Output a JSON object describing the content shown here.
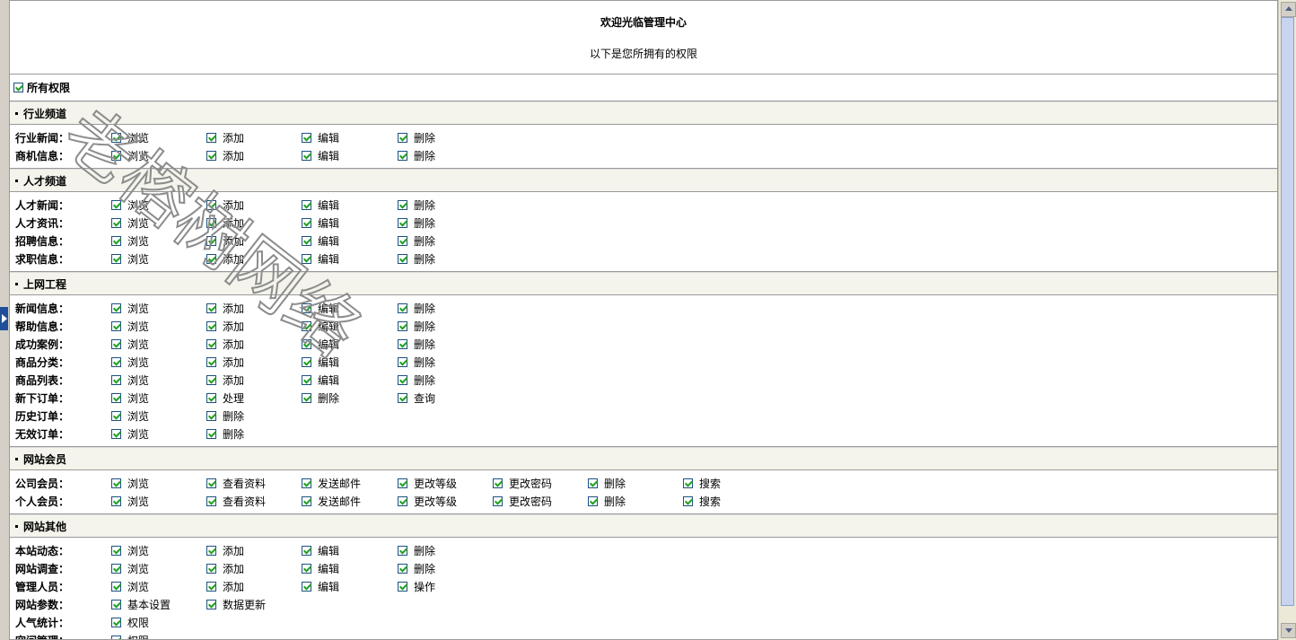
{
  "header": {
    "welcome": "欢迎光临管理中心",
    "subtitle": "以下是您所拥有的权限"
  },
  "all_permissions": {
    "label": "所有权限",
    "checked": true
  },
  "sections": [
    {
      "title": "行业频道",
      "rows": [
        {
          "label": "行业新闻：",
          "perms": [
            "浏览",
            "添加",
            "编辑",
            "删除"
          ]
        },
        {
          "label": "商机信息：",
          "perms": [
            "浏览",
            "添加",
            "编辑",
            "删除"
          ]
        }
      ]
    },
    {
      "title": "人才频道",
      "rows": [
        {
          "label": "人才新闻：",
          "perms": [
            "浏览",
            "添加",
            "编辑",
            "删除"
          ]
        },
        {
          "label": "人才资讯：",
          "perms": [
            "浏览",
            "添加",
            "编辑",
            "删除"
          ]
        },
        {
          "label": "招聘信息：",
          "perms": [
            "浏览",
            "添加",
            "编辑",
            "删除"
          ]
        },
        {
          "label": "求职信息：",
          "perms": [
            "浏览",
            "添加",
            "编辑",
            "删除"
          ]
        }
      ]
    },
    {
      "title": "上网工程",
      "rows": [
        {
          "label": "新闻信息：",
          "perms": [
            "浏览",
            "添加",
            "编辑",
            "删除"
          ]
        },
        {
          "label": "帮助信息：",
          "perms": [
            "浏览",
            "添加",
            "编辑",
            "删除"
          ]
        },
        {
          "label": "成功案例：",
          "perms": [
            "浏览",
            "添加",
            "编辑",
            "删除"
          ]
        },
        {
          "label": "商品分类：",
          "perms": [
            "浏览",
            "添加",
            "编辑",
            "删除"
          ]
        },
        {
          "label": "商品列表：",
          "perms": [
            "浏览",
            "添加",
            "编辑",
            "删除"
          ]
        },
        {
          "label": "新下订单：",
          "perms": [
            "浏览",
            "处理",
            "删除",
            "查询"
          ]
        },
        {
          "label": "历史订单：",
          "perms": [
            "浏览",
            "删除"
          ]
        },
        {
          "label": "无效订单：",
          "perms": [
            "浏览",
            "删除"
          ]
        }
      ]
    },
    {
      "title": "网站会员",
      "rows": [
        {
          "label": "公司会员：",
          "perms": [
            "浏览",
            "查看资料",
            "发送邮件",
            "更改等级",
            "更改密码",
            "删除",
            "搜索"
          ]
        },
        {
          "label": "个人会员：",
          "perms": [
            "浏览",
            "查看资料",
            "发送邮件",
            "更改等级",
            "更改密码",
            "删除",
            "搜索"
          ]
        }
      ]
    },
    {
      "title": "网站其他",
      "rows": [
        {
          "label": "本站动态：",
          "perms": [
            "浏览",
            "添加",
            "编辑",
            "删除"
          ]
        },
        {
          "label": "网站调查：",
          "perms": [
            "浏览",
            "添加",
            "编辑",
            "删除"
          ]
        },
        {
          "label": "管理人员：",
          "perms": [
            "浏览",
            "添加",
            "编辑",
            "操作"
          ]
        },
        {
          "label": "网站参数：",
          "perms": [
            "基本设置",
            "数据更新"
          ]
        },
        {
          "label": "人气统计：",
          "perms": [
            "权限"
          ]
        },
        {
          "label": "空间管理：",
          "perms": [
            "权限"
          ]
        }
      ]
    }
  ],
  "watermark": "老榕树网络",
  "colors": {
    "check": "#21a121",
    "checkbox_border": "#1c5180",
    "section_bg": "#f4f4ec",
    "toggle": "#1f4f9a"
  },
  "icons": {
    "left_toggle": "chevron-right-icon",
    "scroll_up": "scroll-up-icon",
    "scroll_down": "scroll-down-icon"
  }
}
